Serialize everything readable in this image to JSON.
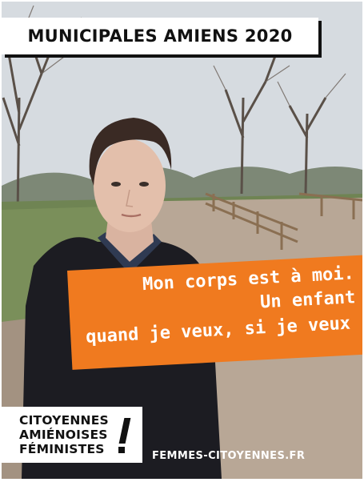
{
  "poster": {
    "title": "MUNICIPALES AMIENS 2020",
    "slogan": {
      "line1": "Mon corps est à moi.",
      "line2": "Un enfant",
      "line3": "quand je veux, si je veux"
    },
    "logo": {
      "line1": "CITOYENNES",
      "line2": "AMIÉNOISES",
      "line3": "FÉMINISTES"
    },
    "website": "FEMMES-CITOYENNES.FR"
  },
  "colors": {
    "accent_orange": "#f07a1f",
    "title_bg": "#ffffff",
    "text_dark": "#111111"
  }
}
